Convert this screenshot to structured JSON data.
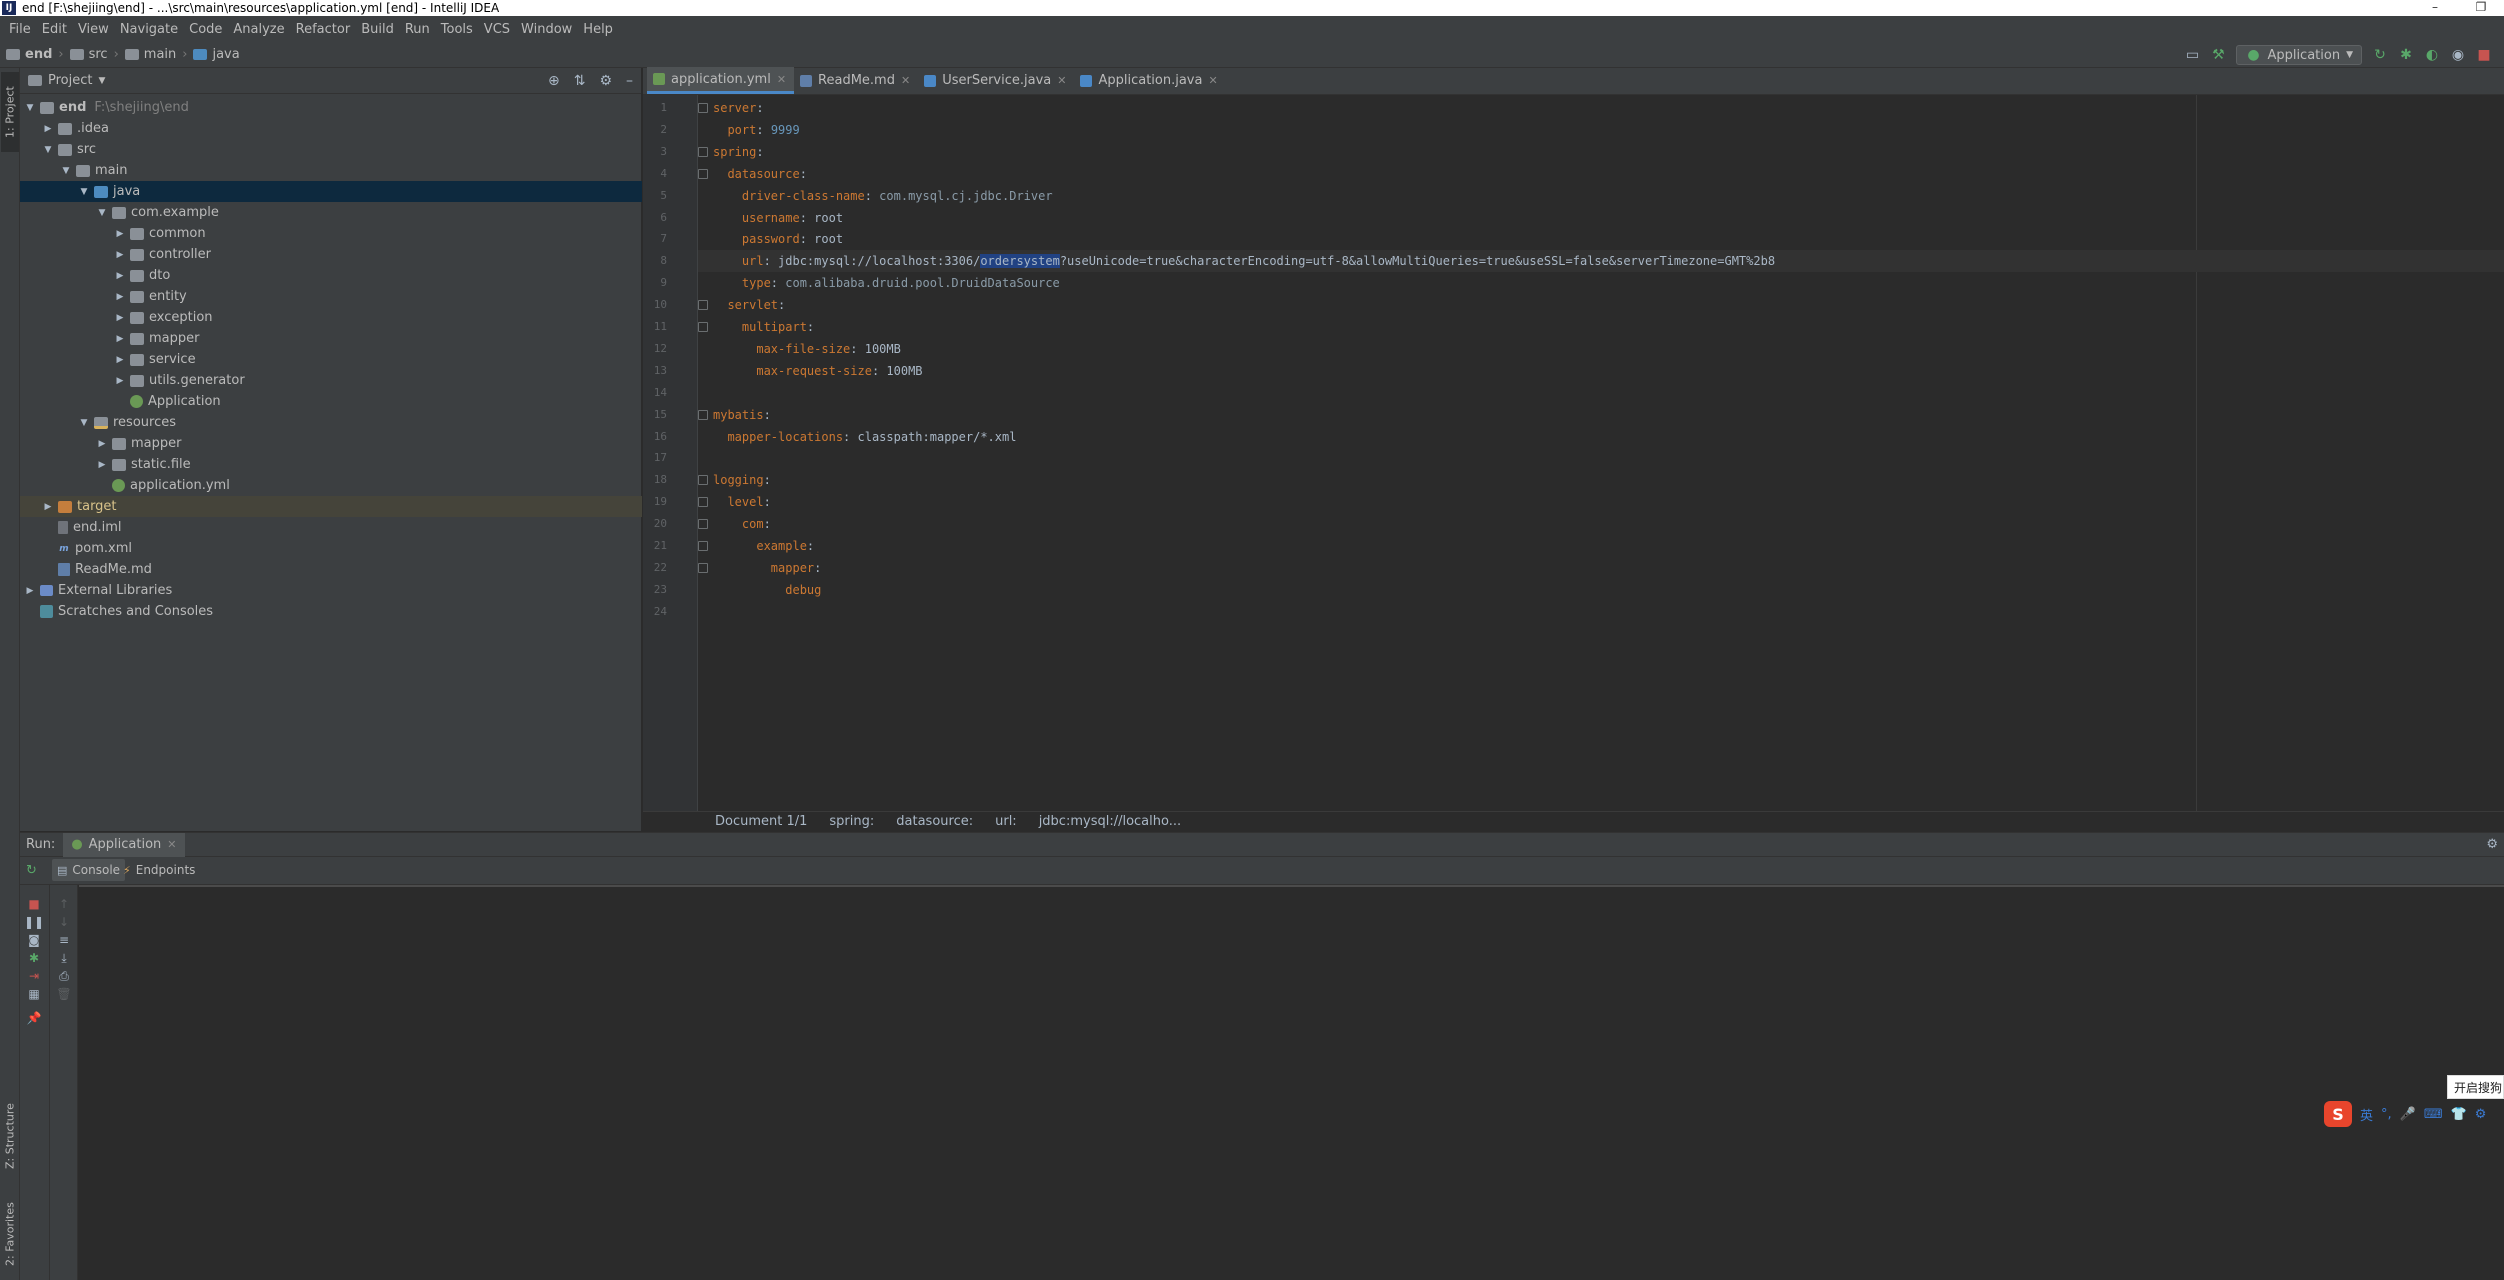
{
  "window": {
    "title": "end [F:\\shejiing\\end] - ...\\src\\main\\resources\\application.yml [end] - IntelliJ IDEA",
    "controls": [
      "–",
      "❐"
    ]
  },
  "menu": [
    "File",
    "Edit",
    "View",
    "Navigate",
    "Code",
    "Analyze",
    "Refactor",
    "Build",
    "Run",
    "Tools",
    "VCS",
    "Window",
    "Help"
  ],
  "breadcrumb": [
    "end",
    "src",
    "main",
    "java"
  ],
  "toolbar": {
    "run_config": "Application"
  },
  "left_strip": {
    "project": "1: Project",
    "structure": "Z: Structure",
    "favorites": "2: Favorites"
  },
  "project": {
    "title": "Project",
    "tree": [
      {
        "label": "end",
        "hint": "F:\\shejiing\\end",
        "depth": 0,
        "arrow": "▼",
        "icon": "folder",
        "bold": true
      },
      {
        "label": ".idea",
        "depth": 1,
        "arrow": "▶",
        "icon": "folder"
      },
      {
        "label": "src",
        "depth": 1,
        "arrow": "▼",
        "icon": "folder"
      },
      {
        "label": "main",
        "depth": 2,
        "arrow": "▼",
        "icon": "folder"
      },
      {
        "label": "java",
        "depth": 3,
        "arrow": "▼",
        "icon": "folder-blue",
        "selected": true
      },
      {
        "label": "com.example",
        "depth": 4,
        "arrow": "▼",
        "icon": "pkg"
      },
      {
        "label": "common",
        "depth": 5,
        "arrow": "▶",
        "icon": "pkg"
      },
      {
        "label": "controller",
        "depth": 5,
        "arrow": "▶",
        "icon": "pkg"
      },
      {
        "label": "dto",
        "depth": 5,
        "arrow": "▶",
        "icon": "pkg"
      },
      {
        "label": "entity",
        "depth": 5,
        "arrow": "▶",
        "icon": "pkg"
      },
      {
        "label": "exception",
        "depth": 5,
        "arrow": "▶",
        "icon": "pkg"
      },
      {
        "label": "mapper",
        "depth": 5,
        "arrow": "▶",
        "icon": "pkg"
      },
      {
        "label": "service",
        "depth": 5,
        "arrow": "▶",
        "icon": "pkg"
      },
      {
        "label": "utils.generator",
        "depth": 5,
        "arrow": "▶",
        "icon": "pkg"
      },
      {
        "label": "Application",
        "depth": 5,
        "arrow": "",
        "icon": "spring"
      },
      {
        "label": "resources",
        "depth": 3,
        "arrow": "▼",
        "icon": "folder-res"
      },
      {
        "label": "mapper",
        "depth": 4,
        "arrow": "▶",
        "icon": "folder"
      },
      {
        "label": "static.file",
        "depth": 4,
        "arrow": "▶",
        "icon": "folder"
      },
      {
        "label": "application.yml",
        "depth": 4,
        "arrow": "",
        "icon": "spring"
      },
      {
        "label": "target",
        "depth": 1,
        "arrow": "▶",
        "icon": "folder-orange",
        "highlight": true
      },
      {
        "label": "end.iml",
        "depth": 1,
        "arrow": "",
        "icon": "file"
      },
      {
        "label": "pom.xml",
        "depth": 1,
        "arrow": "",
        "icon": "maven"
      },
      {
        "label": "ReadMe.md",
        "depth": 1,
        "arrow": "",
        "icon": "md"
      },
      {
        "label": "External Libraries",
        "depth": 0,
        "arrow": "▶",
        "icon": "lib"
      },
      {
        "label": "Scratches and Consoles",
        "depth": 0,
        "arrow": "",
        "icon": "scratch"
      }
    ]
  },
  "editor": {
    "tabs": [
      {
        "label": "application.yml",
        "active": true,
        "color": "#6a9955"
      },
      {
        "label": "ReadMe.md",
        "active": false,
        "color": "#5f7ea8"
      },
      {
        "label": "UserService.java",
        "active": false,
        "color": "#4a88c7"
      },
      {
        "label": "Application.java",
        "active": false,
        "color": "#4a88c7"
      }
    ],
    "current_line": 8,
    "lines": [
      [
        {
          "t": "server",
          "c": "k"
        },
        {
          "t": ":",
          "c": "s"
        }
      ],
      [
        {
          "t": "  port",
          "c": "k"
        },
        {
          "t": ": ",
          "c": "s"
        },
        {
          "t": "9999",
          "c": "n"
        }
      ],
      [
        {
          "t": "spring",
          "c": "k"
        },
        {
          "t": ":",
          "c": "s"
        }
      ],
      [
        {
          "t": "  datasource",
          "c": "k"
        },
        {
          "t": ":",
          "c": "s"
        }
      ],
      [
        {
          "t": "    driver-class-name",
          "c": "k"
        },
        {
          "t": ": ",
          "c": "s"
        },
        {
          "t": "com.mysql.cj.jdbc.Driver",
          "c": "pval"
        }
      ],
      [
        {
          "t": "    username",
          "c": "k"
        },
        {
          "t": ": root",
          "c": "s"
        }
      ],
      [
        {
          "t": "    password",
          "c": "k"
        },
        {
          "t": ": root",
          "c": "s"
        }
      ],
      [
        {
          "t": "    url",
          "c": "k"
        },
        {
          "t": ": jdbc:mysql://localhost:3306/",
          "c": "s"
        },
        {
          "t": "ordersystem",
          "c": "sel"
        },
        {
          "t": "?useUnicode=true&characterEncoding=utf-8&allowMultiQueries=true&useSSL=false&serverTimezone=GMT%2b8",
          "c": "s"
        }
      ],
      [
        {
          "t": "    type",
          "c": "k"
        },
        {
          "t": ": ",
          "c": "s"
        },
        {
          "t": "com.alibaba.druid.pool.DruidDataSource",
          "c": "pval"
        }
      ],
      [
        {
          "t": "  servlet",
          "c": "k"
        },
        {
          "t": ":",
          "c": "s"
        }
      ],
      [
        {
          "t": "    multipart",
          "c": "k"
        },
        {
          "t": ":",
          "c": "s"
        }
      ],
      [
        {
          "t": "      max-file-size",
          "c": "k"
        },
        {
          "t": ": 100MB",
          "c": "s"
        }
      ],
      [
        {
          "t": "      max-request-size",
          "c": "k"
        },
        {
          "t": ": 100MB",
          "c": "s"
        }
      ],
      [],
      [
        {
          "t": "mybatis",
          "c": "k"
        },
        {
          "t": ":",
          "c": "s"
        }
      ],
      [
        {
          "t": "  mapper-locations",
          "c": "k"
        },
        {
          "t": ": classpath:mapper/*.xml",
          "c": "s"
        }
      ],
      [],
      [
        {
          "t": "logging",
          "c": "k"
        },
        {
          "t": ":",
          "c": "s"
        }
      ],
      [
        {
          "t": "  level",
          "c": "k"
        },
        {
          "t": ":",
          "c": "s"
        }
      ],
      [
        {
          "t": "    com",
          "c": "k"
        },
        {
          "t": ":",
          "c": "s"
        }
      ],
      [
        {
          "t": "      example",
          "c": "k"
        },
        {
          "t": ":",
          "c": "s"
        }
      ],
      [
        {
          "t": "        mapper",
          "c": "k"
        },
        {
          "t": ":",
          "c": "s"
        }
      ],
      [
        {
          "t": "          debug",
          "c": "k"
        }
      ],
      []
    ],
    "status_breadcrumb": [
      "Document 1/1",
      "spring:",
      "datasource:",
      "url:",
      "jdbc:mysql://localho..."
    ]
  },
  "run": {
    "label": "Run:",
    "tab": "Application",
    "subtabs": [
      "Console",
      "Endpoints"
    ]
  },
  "ime": {
    "tip": "开启搜狗",
    "logo": "S",
    "lang": "英",
    "items": [
      "°,",
      "🎤",
      "⌨",
      "👕",
      "⚙"
    ]
  }
}
